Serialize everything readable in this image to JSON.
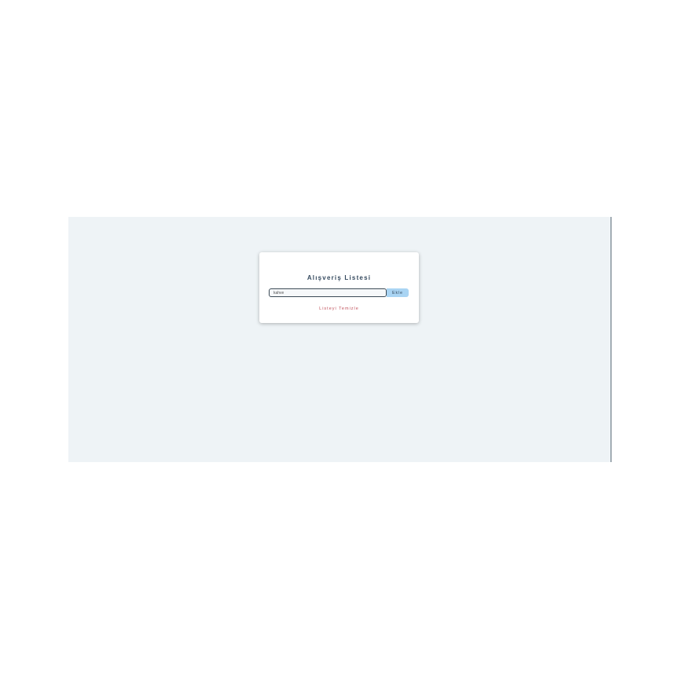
{
  "app": {
    "title": "Alışveriş Listesi"
  },
  "form": {
    "input_value": "kahve",
    "add_label": "Ekle"
  },
  "actions": {
    "clear_label": "Listeyi Temizle"
  },
  "colors": {
    "background": "#eef3f6",
    "card": "#ffffff",
    "title": "#34495e",
    "button": "#a9d4f3",
    "clear_link": "#c0505a"
  }
}
